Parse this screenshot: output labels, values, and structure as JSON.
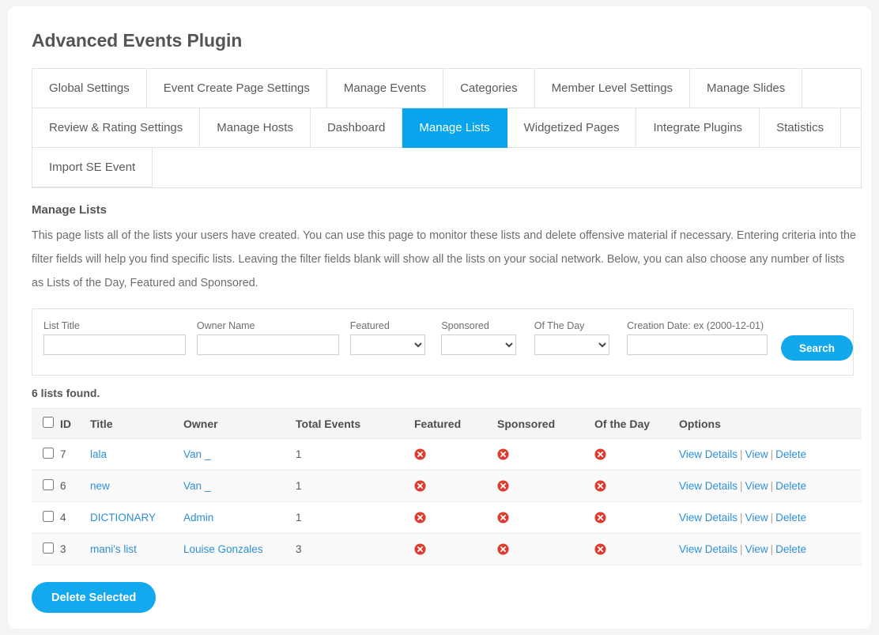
{
  "app": {
    "title": "Advanced Events Plugin"
  },
  "tabs": [
    {
      "label": "Global Settings",
      "active": false
    },
    {
      "label": "Event Create Page Settings",
      "active": false
    },
    {
      "label": "Manage Events",
      "active": false
    },
    {
      "label": "Categories",
      "active": false
    },
    {
      "label": "Member Level Settings",
      "active": false
    },
    {
      "label": "Manage Slides",
      "active": false
    },
    {
      "label": "Review & Rating Settings",
      "active": false
    },
    {
      "label": "Manage Hosts",
      "active": false
    },
    {
      "label": "Dashboard",
      "active": false
    },
    {
      "label": "Manage Lists",
      "active": true
    },
    {
      "label": "Widgetized Pages",
      "active": false
    },
    {
      "label": "Integrate Plugins",
      "active": false
    },
    {
      "label": "Statistics",
      "active": false
    },
    {
      "label": "Import SE Event",
      "active": false
    }
  ],
  "section": {
    "title": "Manage Lists",
    "description": "This page lists all of the lists your users have created. You can use this page to monitor these lists and delete offensive material if necessary. Entering criteria into the filter fields will help you find specific lists. Leaving the filter fields blank will show all the lists on your social network. Below, you can also choose any number of lists as Lists of the Day, Featured and Sponsored."
  },
  "filters": {
    "list_title": {
      "label": "List Title",
      "value": "",
      "placeholder": ""
    },
    "owner_name": {
      "label": "Owner Name",
      "value": "",
      "placeholder": ""
    },
    "featured": {
      "label": "Featured",
      "selected": "",
      "options": [
        ""
      ]
    },
    "sponsored": {
      "label": "Sponsored",
      "selected": "",
      "options": [
        ""
      ]
    },
    "of_the_day": {
      "label": "Of The Day",
      "selected": "",
      "options": [
        ""
      ]
    },
    "creation_date": {
      "label": "Creation Date: ex (2000-12-01)",
      "value": "",
      "placeholder": ""
    },
    "search_button": "Search"
  },
  "results": {
    "count_text": "6 lists found.",
    "columns": {
      "select_all": "",
      "id": "ID",
      "title": "Title",
      "owner": "Owner",
      "total_events": "Total Events",
      "featured": "Featured",
      "sponsored": "Sponsored",
      "of_the_day": "Of the Day",
      "options": "Options"
    },
    "option_labels": {
      "view_details": "View Details",
      "view": "View",
      "delete": "Delete",
      "separator": "|"
    },
    "status_icon": "cross-circle-icon",
    "rows": [
      {
        "checked": false,
        "id": "7",
        "title": "lala",
        "owner": "Van _",
        "total_events": "1",
        "featured": false,
        "sponsored": false,
        "of_the_day": false
      },
      {
        "checked": false,
        "id": "6",
        "title": "new",
        "owner": "Van _",
        "total_events": "1",
        "featured": false,
        "sponsored": false,
        "of_the_day": false
      },
      {
        "checked": false,
        "id": "4",
        "title": "DICTIONARY",
        "owner": "Admin",
        "total_events": "1",
        "featured": false,
        "sponsored": false,
        "of_the_day": false
      },
      {
        "checked": false,
        "id": "3",
        "title": "mani's list",
        "owner": "Louise Gonzales",
        "total_events": "3",
        "featured": false,
        "sponsored": false,
        "of_the_day": false
      }
    ]
  },
  "footer": {
    "delete_selected": "Delete Selected"
  },
  "colors": {
    "accent": "#08a5ec",
    "button": "#14a9ee",
    "link": "#2d8fd5",
    "danger": "#e03a2f",
    "page_bg": "#f4f4f4",
    "card_bg": "#ffffff"
  }
}
